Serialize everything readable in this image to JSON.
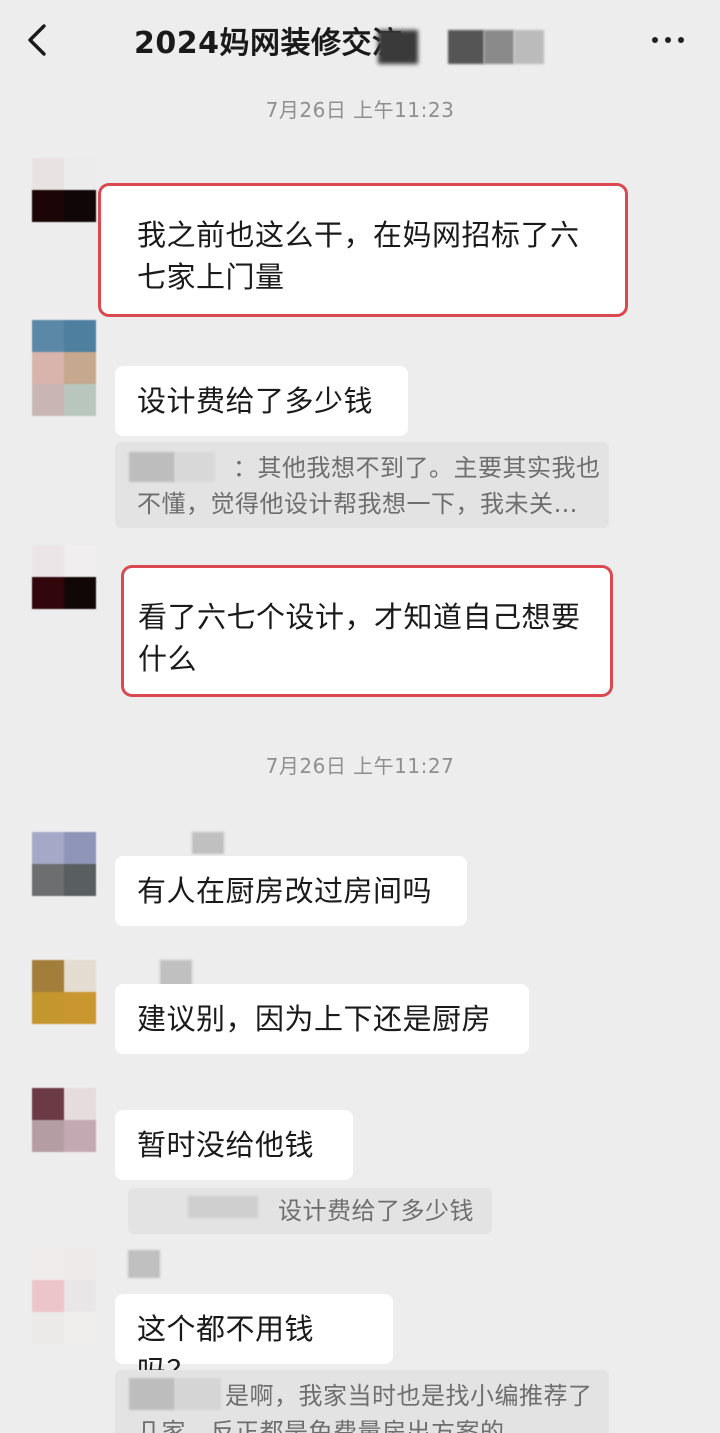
{
  "header": {
    "title": "2024妈网装修交流",
    "back_icon": "chevron-left-icon",
    "more_icon": "more-dots-icon"
  },
  "timestamps": [
    "7月26日 上午11:23",
    "7月26日 上午11:27"
  ],
  "messages": [
    {
      "text": "我之前也这么干，在妈网招标了六七家上门量"
    },
    {
      "text": "设计费给了多少钱",
      "quote": "：其他我想不到了。主要其实我也不懂，觉得他设计帮我想一下，我未关…"
    },
    {
      "text": "看了六七个设计，才知道自己想要什么"
    },
    {
      "text": "有人在厨房改过房间吗"
    },
    {
      "text": "建议别，因为上下还是厨房"
    },
    {
      "text": "暂时没给他钱",
      "quote": "设计费给了多少钱"
    },
    {
      "text": "这个都不用钱吗？",
      "quote": "是啊，我家当时也是找小编推荐了几家，反正都是免费量房出方案的"
    }
  ],
  "colors": {
    "background": "#ededed",
    "bubble": "#ffffff",
    "highlight": "#d9494f",
    "quote_bg": "#e3e3e3"
  }
}
